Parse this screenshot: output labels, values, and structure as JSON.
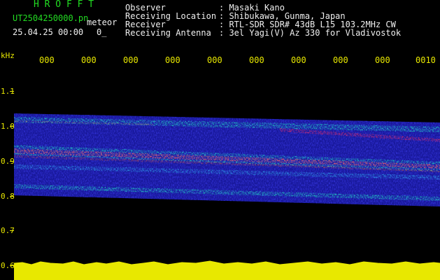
{
  "header": {
    "brand": "H R O F F T",
    "filename": "UT2504250000.pn",
    "type": "meteor",
    "datetime": "25.04.25 00:00",
    "counter": "0_"
  },
  "info": {
    "labels": [
      "Observer",
      "Receiving Location",
      "Receiver",
      "Receiving Antenna"
    ],
    "values": [
      ": Masaki Kano",
      ": Shibukawa, Gunma, Japan",
      ": RTL-SDR SDR# 43dB L15 103.2MHz CW",
      ": 3el Yagi(V) Az 330 for Vladivostok"
    ]
  },
  "axis": {
    "unit": "kHz",
    "yticks": [
      "1.1",
      "1.0",
      "0.9",
      "0.8",
      "0.7",
      "0.6"
    ],
    "xticks": [
      "000",
      "000",
      "000",
      "000",
      "000",
      "000",
      "000",
      "000",
      "000",
      "0010"
    ]
  },
  "colors": {
    "background": "#000000",
    "text_green": "#22dd22",
    "text_white": "#f0f0f0",
    "axis_yellow": "#e8e800",
    "noise_blue": "#1a1aa8",
    "signal_cyan": "#20c0c0",
    "signal_red": "#ff3060"
  }
}
